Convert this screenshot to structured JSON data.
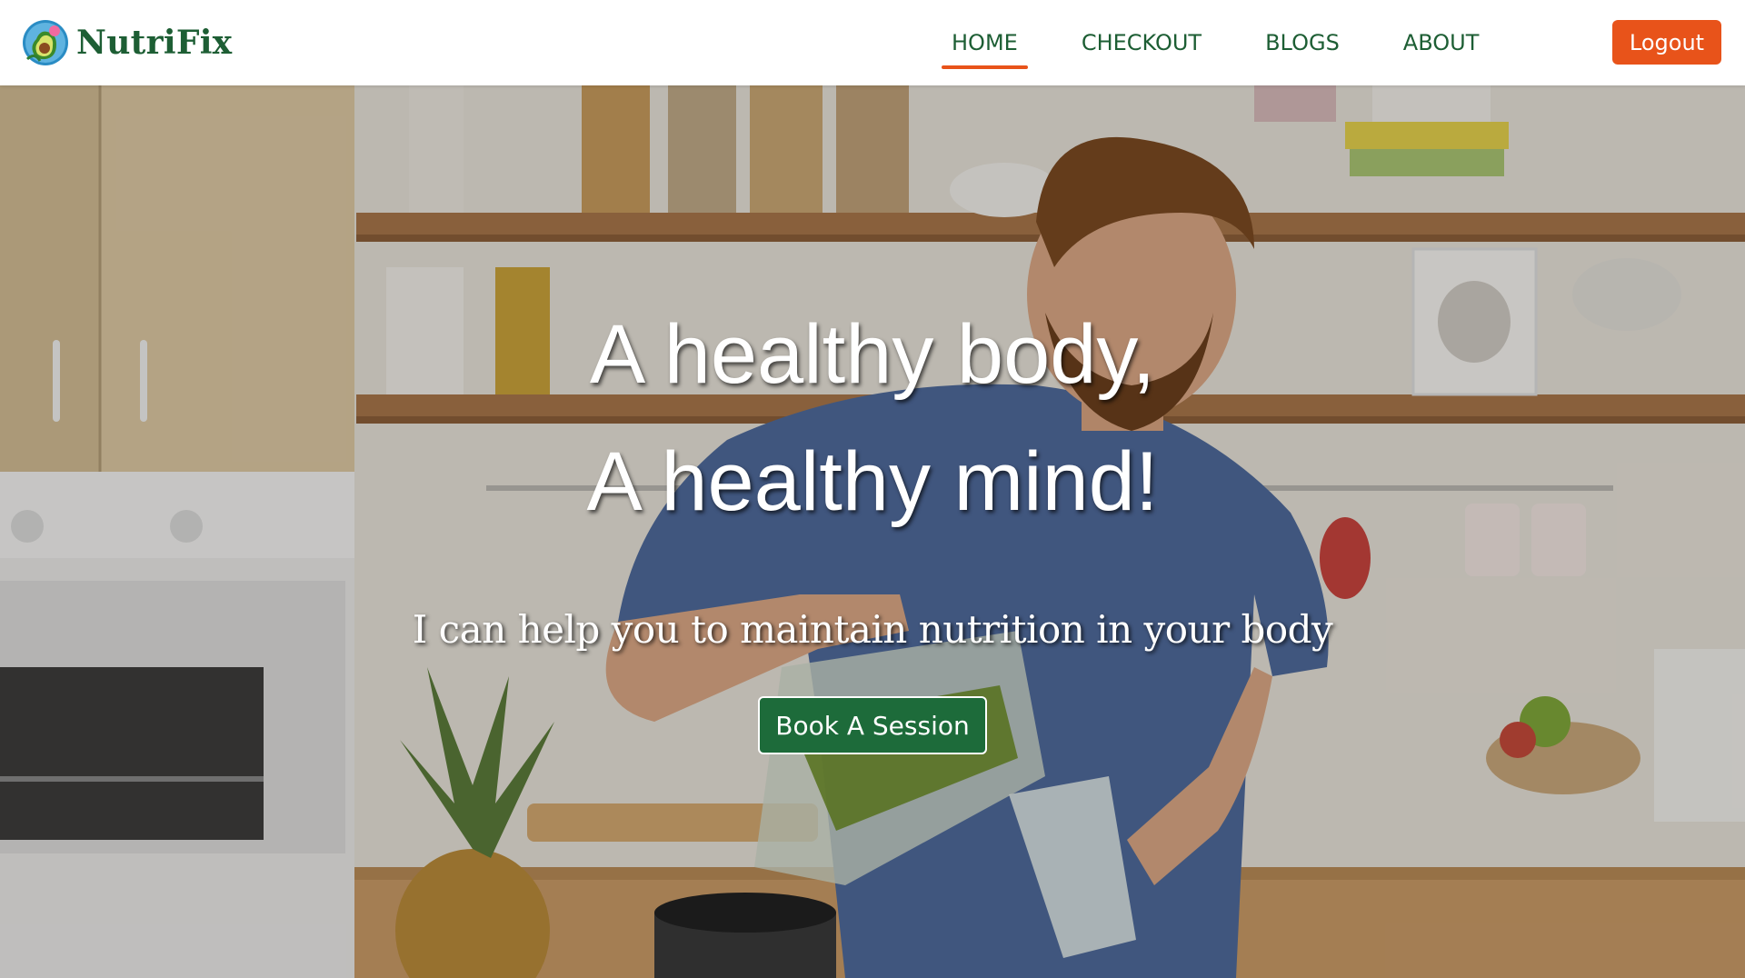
{
  "brand": {
    "name": "NutriFix",
    "logo_icon": "avocado-logo-icon"
  },
  "nav": {
    "items": [
      {
        "label": "HOME",
        "active": true
      },
      {
        "label": "CHECKOUT",
        "active": false
      },
      {
        "label": "BLOGS",
        "active": false
      },
      {
        "label": "ABOUT",
        "active": false
      }
    ],
    "logout_label": "Logout"
  },
  "hero": {
    "title_line1": "A healthy body,",
    "title_line2": "A healthy mind!",
    "subtitle": "I can help you to maintain nutrition in your body",
    "cta_label": "Book A Session"
  },
  "colors": {
    "brand_green": "#1d5e34",
    "accent_orange": "#e8531a",
    "cta_green": "#1d6b3a"
  }
}
